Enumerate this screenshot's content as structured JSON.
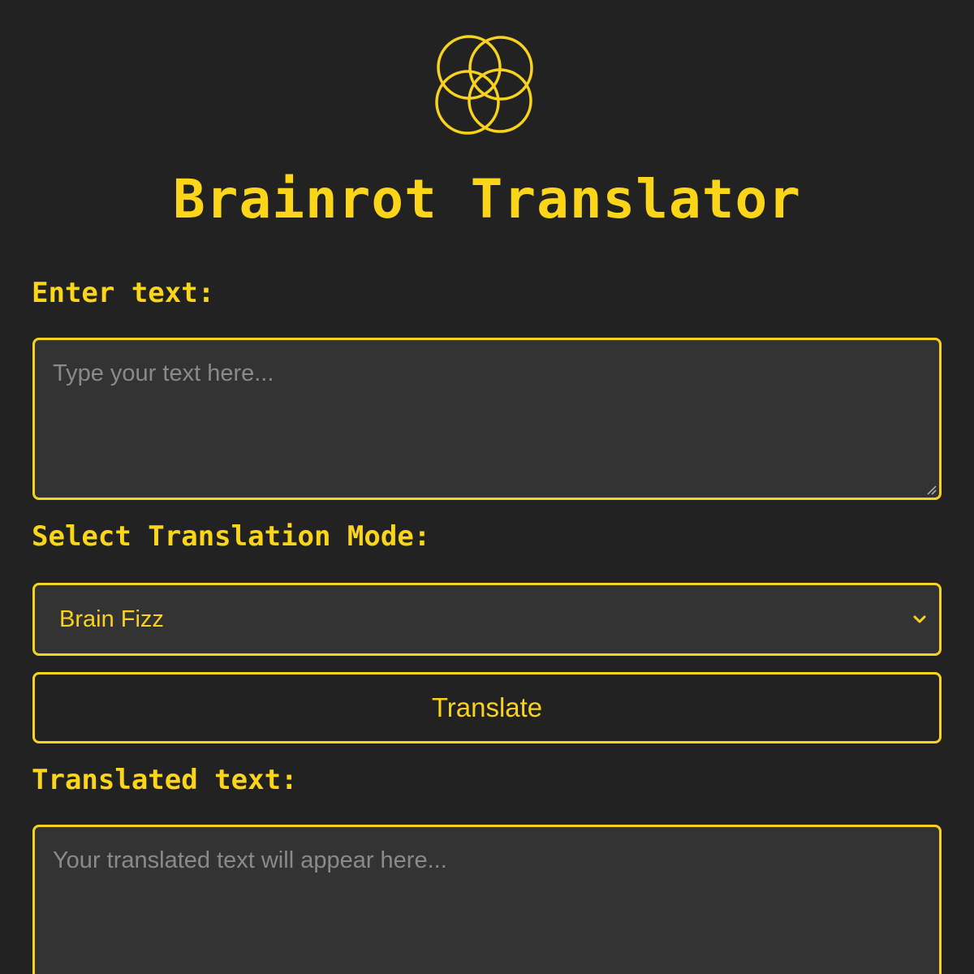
{
  "header": {
    "logo_icon": "overlapping-circles-icon",
    "title": "Brainrot Translator"
  },
  "input_section": {
    "label": "Enter text:",
    "placeholder": "Type your text here...",
    "value": ""
  },
  "mode_section": {
    "label": "Select Translation Mode:",
    "selected": "Brain Fizz",
    "dropdown_icon": "chevron-down-icon"
  },
  "translate_button": {
    "label": "Translate"
  },
  "output_section": {
    "label": "Translated text:",
    "placeholder": "Your translated text will appear here...",
    "value": ""
  },
  "colors": {
    "background": "#222222",
    "field_background": "#333333",
    "accent": "#f7d21e",
    "placeholder": "#8a8a8a"
  }
}
